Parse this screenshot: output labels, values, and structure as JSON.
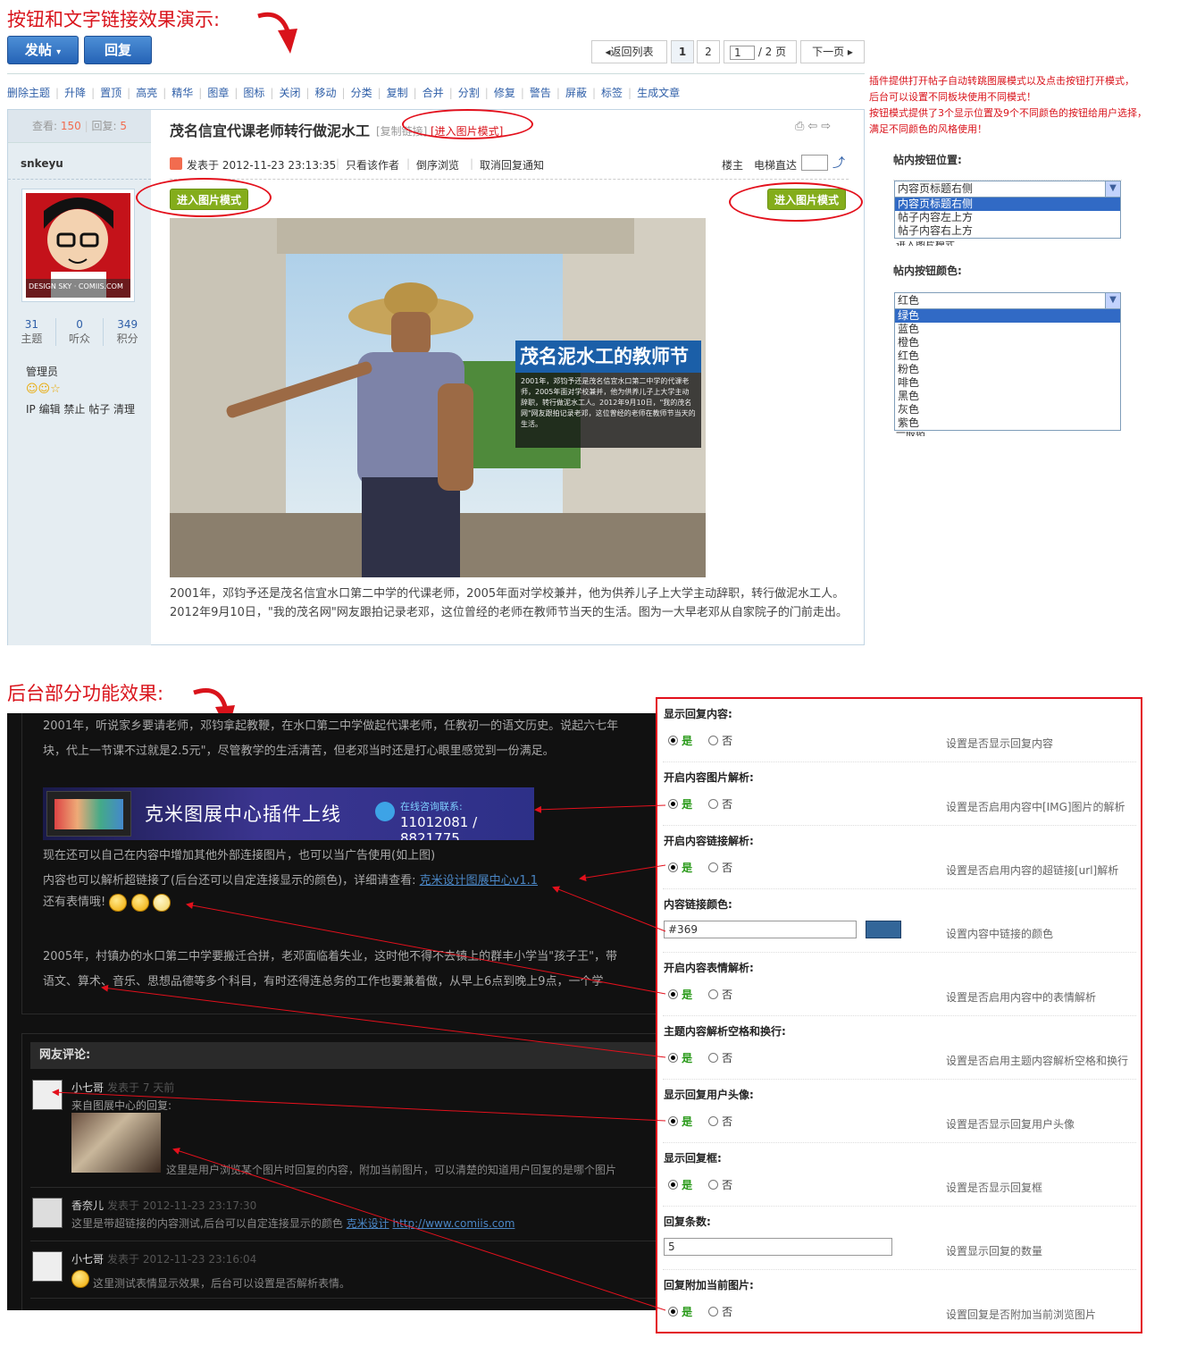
{
  "top_heading": "按钮和文字链接效果演示:",
  "post_button": "发帖",
  "reply_button": "回复",
  "pager": {
    "back": "返回列表",
    "p1": "1",
    "p2": "2",
    "input": "1",
    "total": "/ 2 页",
    "next": "下一页"
  },
  "mod_links": [
    "删除主题",
    "升降",
    "置顶",
    "高亮",
    "精华",
    "图章",
    "图标",
    "关闭",
    "移动",
    "分类",
    "复制",
    "合并",
    "分割",
    "修复",
    "警告",
    "屏蔽",
    "标签",
    "生成文章"
  ],
  "stats": {
    "view_label": "查看:",
    "view_value": "150",
    "reply_label": "回复:",
    "reply_value": "5"
  },
  "thread_title": "茂名信宜代课老师转行做泥水工",
  "copy_link": "[复制链接]",
  "enter_image_mode_link": "[进入图片模式]",
  "author": {
    "name": "snkeyu",
    "avatar_caption": "DESIGN SKY · COMIIS.COM",
    "threads": "31",
    "threads_label": "主题",
    "fans": "0",
    "fans_label": "听众",
    "credits": "349",
    "credits_label": "积分",
    "group": "管理员",
    "admin_links": "IP 编辑 禁止 帖子 清理"
  },
  "post_meta": {
    "posted": "发表于 2012-11-23 23:13:35",
    "only_author": "只看该作者",
    "reverse": "倒序浏览",
    "cancel_notice": "取消回复通知",
    "floor": "楼主",
    "elevator": "电梯直达"
  },
  "image_mode_button": "进入图片模式",
  "photo_caption_title": "茂名泥水工的教师节",
  "photo_caption_body": "2001年，邓钧予还是茂名信宜水口第二中学的代课老师，2005年面对学校兼并，他为供养儿子上大学主动辞职，转行做泥水工人。2012年9月10日，\"我的茂名网\"网友跟拍记录老邓，这位曾经的老师在教师节当天的生活。",
  "post_body": "2001年，邓钧予还是茂名信宜水口第二中学的代课老师，2005年面对学校兼并，他为供养儿子上大学主动辞职，转行做泥水工人。2012年9月10日，\"我的茂名网\"网友跟拍记录老邓，这位曾经的老师在教师节当天的生活。图为一大早老邓从自家院子的门前走出。",
  "plugin_note": [
    "插件提供打开帖子自动转跳图展模式以及点击按钮打开模式，",
    "后台可以设置不同板块使用不同模式！",
    "按钮模式提供了3个显示位置及9个不同颜色的按钮给用户选择，",
    "满足不同颜色的风格使用！"
  ],
  "position_select": {
    "label": "帖内按钮位置:",
    "current": "内容页标题右侧",
    "options": [
      "内容页标题右侧",
      "帖子内容左上方",
      "帖子内容右上方"
    ],
    "under": "进入图片模式"
  },
  "color_select": {
    "label": "帖内按钮颜色:",
    "current": "红色",
    "options": [
      "绿色",
      "蓝色",
      "橙色",
      "红色",
      "粉色",
      "啡色",
      "黑色",
      "灰色",
      "紫色"
    ],
    "under": "一般帖"
  },
  "backend_heading": "后台部分功能效果:",
  "dark": {
    "p1": "2001年，听说家乡要请老师，邓钧拿起教鞭，在水口第二中学做起代课老师，任教初一的语文历史。说起六七年",
    "p2": "块，代上一节课不过就是2.5元\"，尽管教学的生活清苦，但老邓当时还是打心眼里感觉到一份满足。",
    "banner_title": "克米图展中心插件上线",
    "banner_contact": "在线咨询联系:",
    "banner_phone": "11012081 / 8821775",
    "p3": "现在还可以自己在内容中增加其他外部连接图片，也可以当广告使用(如上图)",
    "p4_prefix": "内容也可以解析超链接了(后台还可以自定连接显示的颜色)，详细请查看: ",
    "p4_link": "克米设计图展中心v1.1",
    "p5": "还有表情哦!",
    "p6": "2005年，村镇办的水口第二中学要搬迁合拼，老邓面临着失业，这时他不得不去镇上的群丰小学当\"孩子王\"，带",
    "p7": "语文、算术、音乐、思想品德等多个科目，有时还得连总务的工作也要兼着做，从早上6点到晚上9点，一个学",
    "comments_title": "网友评论:",
    "comments": [
      {
        "name": "小七哥",
        "meta": "发表于 7 天前",
        "line1": "来自图展中心的回复:",
        "line2": "这里是用户浏览某个图片时回复的内容，附加当前图片，可以清楚的知道用户回复的是哪个图片"
      },
      {
        "name": "香奈儿",
        "meta": "发表于 2012-11-23 23:17:30",
        "line1": "这里是带超链接的内容测试,后台可以自定连接显示的颜色 ",
        "link1": "克米设计",
        "link2": "http://www.comiis.com"
      },
      {
        "name": "小七哥",
        "meta": "发表于 2012-11-23 23:16:04",
        "line1": "这里测试表情显示效果，后台可以设置是否解析表情。"
      }
    ]
  },
  "settings": {
    "yes": "是",
    "no": "否",
    "rows": [
      {
        "title": "显示回复内容:",
        "hint": "设置是否显示回复内容"
      },
      {
        "title": "开启内容图片解析:",
        "hint": "设置是否启用内容中[IMG]图片的解析"
      },
      {
        "title": "开启内容链接解析:",
        "hint": "设置是否启用内容的超链接[url]解析"
      },
      {
        "title": "内容链接颜色:",
        "hint": "设置内容中链接的颜色",
        "input": "#369"
      },
      {
        "title": "开启内容表情解析:",
        "hint": "设置是否启用内容中的表情解析"
      },
      {
        "title": "主题内容解析空格和换行:",
        "hint": "设置是否启用主题内容解析空格和换行"
      },
      {
        "title": "显示回复用户头像:",
        "hint": "设置是否显示回复用户头像"
      },
      {
        "title": "显示回复框:",
        "hint": "设置是否显示回复框"
      },
      {
        "title": "回复条数:",
        "hint": "设置显示回复的数量",
        "input": "5"
      },
      {
        "title": "回复附加当前图片:",
        "hint": "设置回复是否附加当前浏览图片"
      }
    ]
  },
  "colors": {
    "accent_red": "#d9131b",
    "link_color": "#336699",
    "button_blue": "#2563b6",
    "button_green": "#84ad1b"
  }
}
